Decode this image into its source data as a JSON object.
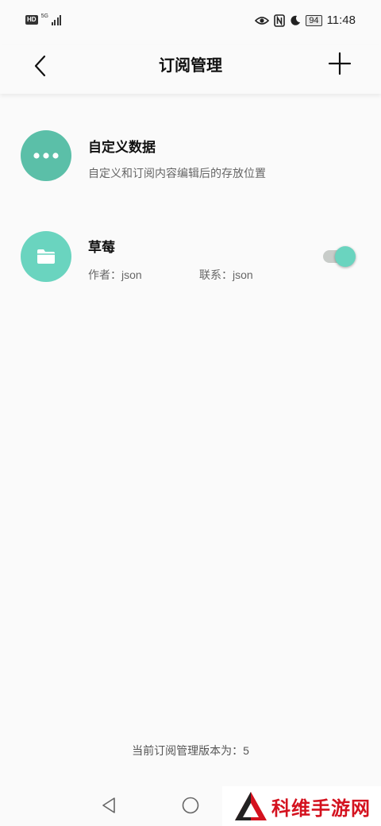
{
  "status_bar": {
    "hd_badge": "HD",
    "network_label": "5G",
    "battery": "94",
    "time": "11:48",
    "icons": [
      "signal-icon",
      "eye-icon",
      "nfc-icon",
      "moon-icon",
      "battery-icon"
    ]
  },
  "header": {
    "title": "订阅管理",
    "back_icon": "back-arrow-icon",
    "add_icon": "plus-icon"
  },
  "items": [
    {
      "title": "自定义数据",
      "description": "自定义和订阅内容编辑后的存放位置",
      "icon": "more-dots-icon",
      "color": "#5bbfa8"
    },
    {
      "title": "草莓",
      "author": "作者：json",
      "contact": "联系：json",
      "icon": "folder-icon",
      "color": "#6ad4bf",
      "enabled": true
    }
  ],
  "footer": {
    "version_text": "当前订阅管理版本为：5"
  },
  "nav_bar": {
    "icons": [
      "nav-back-icon",
      "nav-home-icon"
    ]
  },
  "watermark": {
    "text": "科维手游网"
  }
}
